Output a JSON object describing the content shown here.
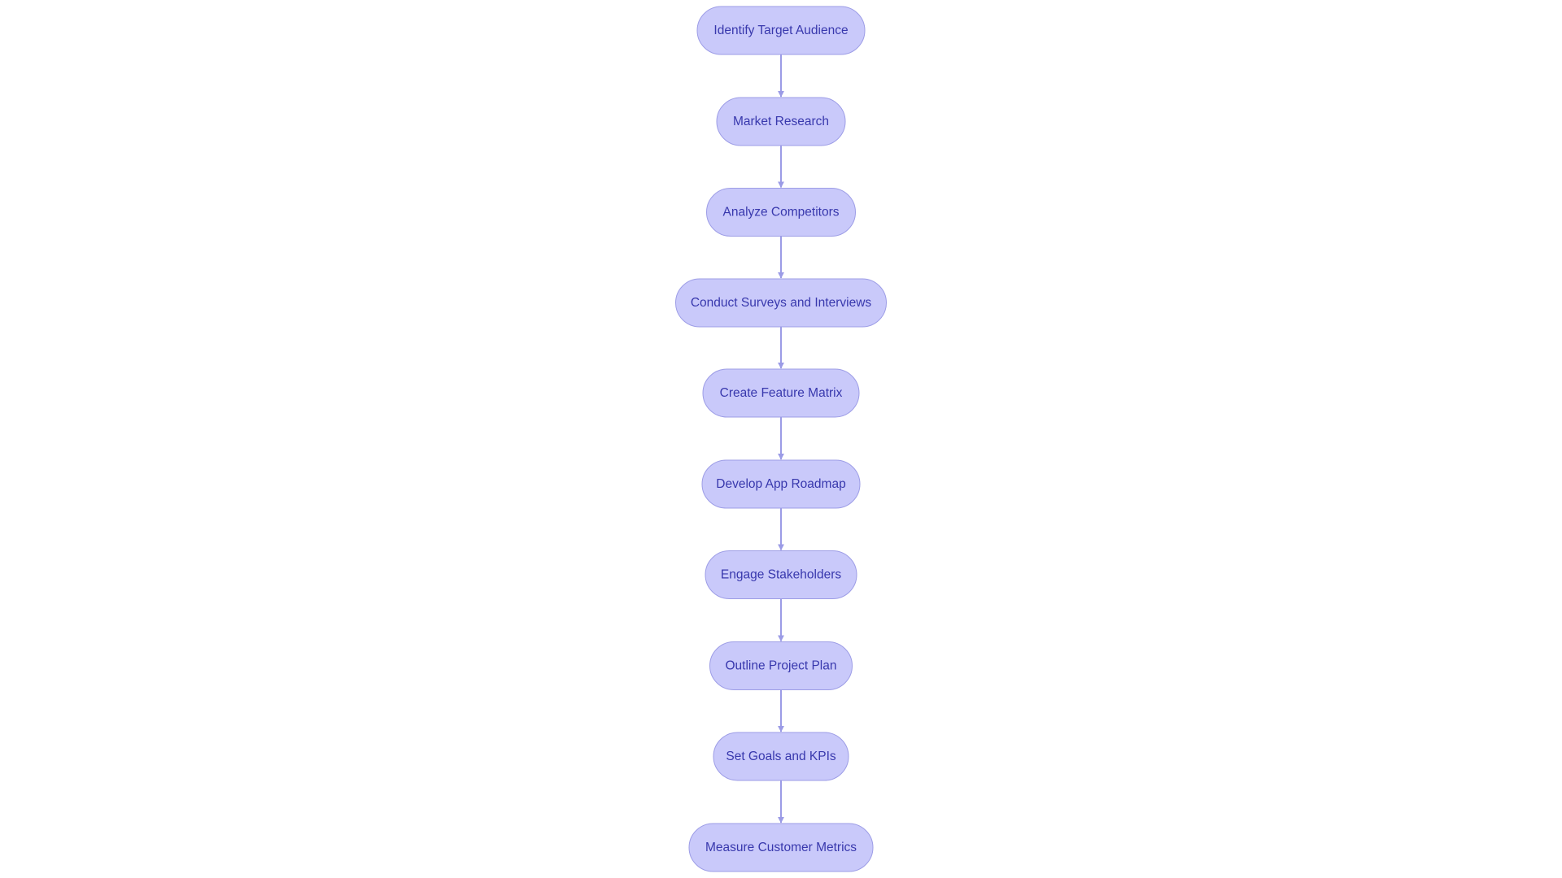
{
  "diagram": {
    "type": "flowchart",
    "direction": "top-to-bottom",
    "colors": {
      "node_fill": "#c9c9fa",
      "node_stroke": "#9d9de6",
      "edge": "#9b9be6",
      "text": "#3838ad",
      "background": "#ffffff"
    },
    "nodes": [
      {
        "id": "n1",
        "label": "Identify Target Audience"
      },
      {
        "id": "n2",
        "label": "Market Research"
      },
      {
        "id": "n3",
        "label": "Analyze Competitors"
      },
      {
        "id": "n4",
        "label": "Conduct Surveys and Interviews"
      },
      {
        "id": "n5",
        "label": "Create Feature Matrix"
      },
      {
        "id": "n6",
        "label": "Develop App Roadmap"
      },
      {
        "id": "n7",
        "label": "Engage Stakeholders"
      },
      {
        "id": "n8",
        "label": "Outline Project Plan"
      },
      {
        "id": "n9",
        "label": "Set Goals and KPIs"
      },
      {
        "id": "n10",
        "label": "Measure Customer Metrics"
      }
    ],
    "edges": [
      {
        "from": "n1",
        "to": "n2"
      },
      {
        "from": "n2",
        "to": "n3"
      },
      {
        "from": "n3",
        "to": "n4"
      },
      {
        "from": "n4",
        "to": "n5"
      },
      {
        "from": "n5",
        "to": "n6"
      },
      {
        "from": "n6",
        "to": "n7"
      },
      {
        "from": "n7",
        "to": "n8"
      },
      {
        "from": "n8",
        "to": "n9"
      },
      {
        "from": "n9",
        "to": "n10"
      }
    ]
  }
}
